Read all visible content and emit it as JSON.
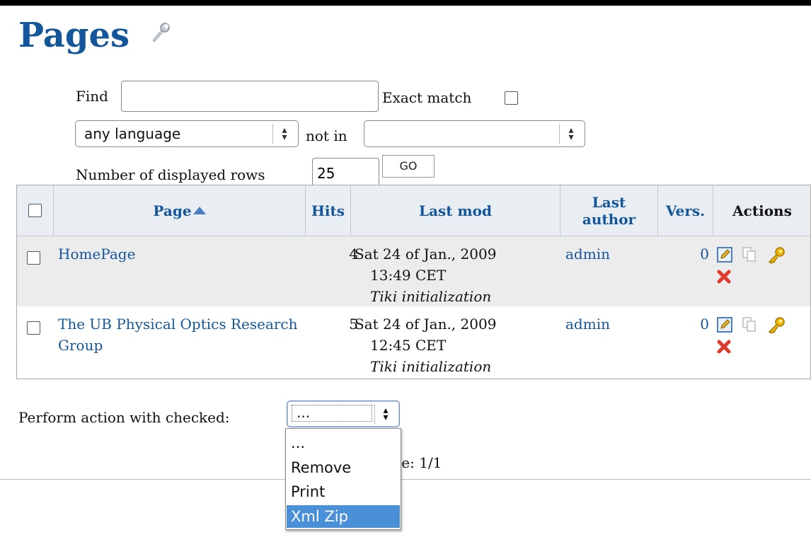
{
  "header": {
    "title": "Pages",
    "title_icon": "wrench-icon"
  },
  "filters": {
    "find_label": "Find",
    "find_value": "",
    "exact_match_label": "Exact match",
    "exact_match_checked": false,
    "language_select": "any language",
    "not_in_label": "not in",
    "not_in_select": "",
    "rows_label": "Number of displayed rows",
    "rows_value": "25",
    "go_label": "GO"
  },
  "table": {
    "columns": {
      "page": "Page",
      "hits": "Hits",
      "last_mod": "Last mod",
      "last_author": "Last author",
      "vers": "Vers.",
      "actions": "Actions"
    },
    "sort": {
      "column": "Page",
      "direction": "ascending"
    },
    "rows": [
      {
        "page": "HomePage",
        "hits": "4",
        "last_mod_date": "Sat 24 of Jan., 2009",
        "last_mod_time": "13:49 CET",
        "last_mod_desc": "Tiki initialization",
        "author": "admin",
        "vers": "0",
        "action_icons": [
          "edit-icon",
          "copy-icon",
          "key-icon",
          "remove-icon"
        ]
      },
      {
        "page": "The UB Physical Optics Research Group",
        "hits": "5",
        "last_mod_date": "Sat 24 of Jan., 2009",
        "last_mod_time": "12:45 CET",
        "last_mod_desc": "Tiki initialization",
        "author": "admin",
        "vers": "0",
        "action_icons": [
          "edit-icon",
          "copy-icon",
          "key-icon",
          "remove-icon"
        ]
      }
    ]
  },
  "bulk": {
    "label": "Perform action with checked:",
    "selected": "...",
    "options": [
      "...",
      "Remove",
      "Print",
      "Xml Zip"
    ],
    "highlighted": "Xml Zip"
  },
  "pagination": {
    "text": "Page: 1/1"
  },
  "colors": {
    "link": "#13569b",
    "header_bg": "#e8eef2",
    "highlight": "#4a90d9"
  }
}
